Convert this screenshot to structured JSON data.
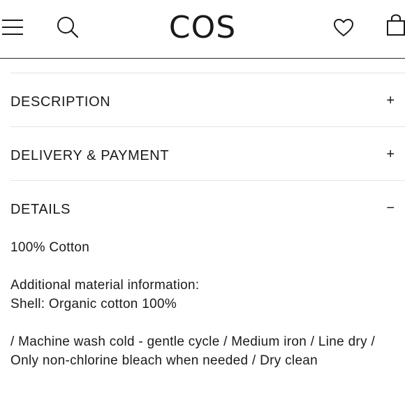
{
  "header": {
    "logo": "COS",
    "menu_icon": "hamburger-menu-icon",
    "search_icon": "search-icon",
    "wishlist_icon": "heart-icon",
    "bag_icon": "shopping-bag-icon"
  },
  "accordion": {
    "description": {
      "title": "DESCRIPTION",
      "toggle": "+"
    },
    "delivery": {
      "title": "DELIVERY & PAYMENT",
      "toggle": "+"
    },
    "details": {
      "title": "DETAILS",
      "toggle": "−"
    }
  },
  "details": {
    "composition": "100% Cotton",
    "material_heading": "Additional material information:",
    "material_line": "Shell: Organic cotton 100%",
    "care": "/ Machine wash cold - gentle cycle / Medium iron / Line dry / Only non-chlorine bleach when needed / Dry clean"
  }
}
